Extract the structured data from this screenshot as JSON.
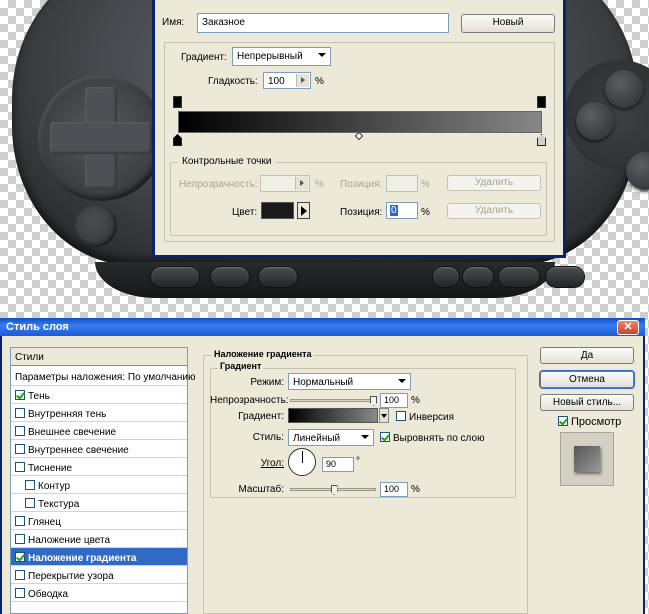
{
  "gradient_editor": {
    "name_label": "Имя:",
    "name_value": "Заказное",
    "new_button": "Новый",
    "gradient_type_label": "Градиент:",
    "gradient_type_value": "Непрерывный",
    "smoothness_label": "Гладкость:",
    "smoothness_value": "100",
    "smoothness_unit": "%",
    "control_points": {
      "title": "Контрольные точки",
      "opacity_label": "Непрозрачность:",
      "opacity_unit": "%",
      "position_label": "Позиция:",
      "position_unit": "%",
      "delete_button": "Удалить",
      "color_label": "Цвет:",
      "color_value": "#1a1a1a",
      "position2_label": "Позиция:",
      "position2_value": "0",
      "position2_unit": "%",
      "delete_button2": "Удалить"
    },
    "gradient_colors": {
      "start": "#000000",
      "end": "#878787"
    }
  },
  "layer_style": {
    "title": "Стиль слоя",
    "close_glyph": "✕",
    "styles_header": "Стили",
    "blending_options": "Параметры наложения: По умолчанию",
    "items": [
      {
        "label": "Тень",
        "checked": true,
        "indent": false,
        "selected": false
      },
      {
        "label": "Внутренняя тень",
        "checked": false,
        "indent": false,
        "selected": false
      },
      {
        "label": "Внешнее свечение",
        "checked": false,
        "indent": false,
        "selected": false
      },
      {
        "label": "Внутреннее свечение",
        "checked": false,
        "indent": false,
        "selected": false
      },
      {
        "label": "Тиснение",
        "checked": false,
        "indent": false,
        "selected": false
      },
      {
        "label": "Контур",
        "checked": false,
        "indent": true,
        "selected": false
      },
      {
        "label": "Текстура",
        "checked": false,
        "indent": true,
        "selected": false
      },
      {
        "label": "Глянец",
        "checked": false,
        "indent": false,
        "selected": false
      },
      {
        "label": "Наложение цвета",
        "checked": false,
        "indent": false,
        "selected": false
      },
      {
        "label": "Наложение градиента",
        "checked": true,
        "indent": false,
        "selected": true
      },
      {
        "label": "Перекрытие узора",
        "checked": false,
        "indent": false,
        "selected": false
      },
      {
        "label": "Обводка",
        "checked": false,
        "indent": false,
        "selected": false
      }
    ],
    "panel": {
      "section_title": "Наложение градиента",
      "group_title": "Градиент",
      "mode_label": "Режим:",
      "mode_value": "Нормальный",
      "opacity_label": "Непрозрачность:",
      "opacity_value": "100",
      "opacity_fraction": 1.0,
      "opacity_unit": "%",
      "gradient_label": "Градиент:",
      "invert_label": "Инверсия",
      "invert_checked": false,
      "style_label": "Стиль:",
      "style_value": "Линейный",
      "align_label": "Выровнять по слою",
      "align_checked": true,
      "angle_label": "Угол:",
      "angle_value": "90",
      "angle_unit": "°",
      "scale_label": "Масштаб:",
      "scale_value": "100",
      "scale_fraction": 0.5,
      "scale_unit": "%"
    },
    "buttons": {
      "ok": "Да",
      "cancel": "Отмена",
      "new_style": "Новый стиль...",
      "preview_label": "Просмотр",
      "preview_checked": true
    }
  },
  "colors": {
    "selection": "#316ac5",
    "title_bar": "#0a4fc8",
    "dialog_bg": "#ece9d8"
  }
}
